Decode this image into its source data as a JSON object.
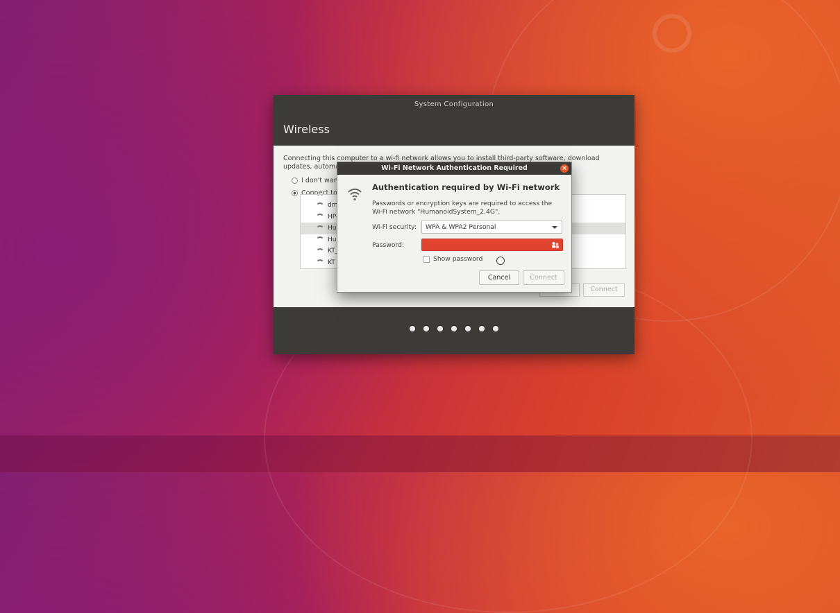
{
  "config_window": {
    "title": "System Configuration",
    "heading": "Wireless",
    "description": "Connecting this computer to a wi-fi network allows you to install third-party software, download updates, automatically de",
    "options": [
      {
        "label": "I don't want",
        "selected": false
      },
      {
        "label": "Connect to t",
        "selected": true
      }
    ],
    "networks": [
      {
        "name": "",
        "secured": true,
        "selected": false
      },
      {
        "name": "dm",
        "secured": true,
        "selected": false
      },
      {
        "name": "HP-",
        "secured": false,
        "selected": false
      },
      {
        "name": "Hun",
        "secured": true,
        "selected": true
      },
      {
        "name": "Hun",
        "secured": true,
        "selected": false
      },
      {
        "name": "KT_",
        "secured": true,
        "selected": false
      },
      {
        "name": "KT",
        "secured": false,
        "selected": false
      }
    ],
    "back_label": "Back",
    "connect_label": "Connect",
    "progress": {
      "steps": 7,
      "current": 6
    }
  },
  "auth_dialog": {
    "title": "Wi-Fi Network Authentication Required",
    "heading": "Authentication required by Wi-Fi network",
    "description": "Passwords or encryption keys are required to access the Wi-Fi network \"HumanoidSystem_2.4G\".",
    "security_label": "Wi-Fi security:",
    "security_value": "WPA & WPA2 Personal",
    "password_label": "Password:",
    "password_value": "",
    "show_password_label": "Show password",
    "cancel_label": "Cancel",
    "connect_label": "Connect"
  },
  "colors": {
    "password_error": "#e0432f",
    "close_button": "#e5572b",
    "titlebar": "#3a3935"
  }
}
